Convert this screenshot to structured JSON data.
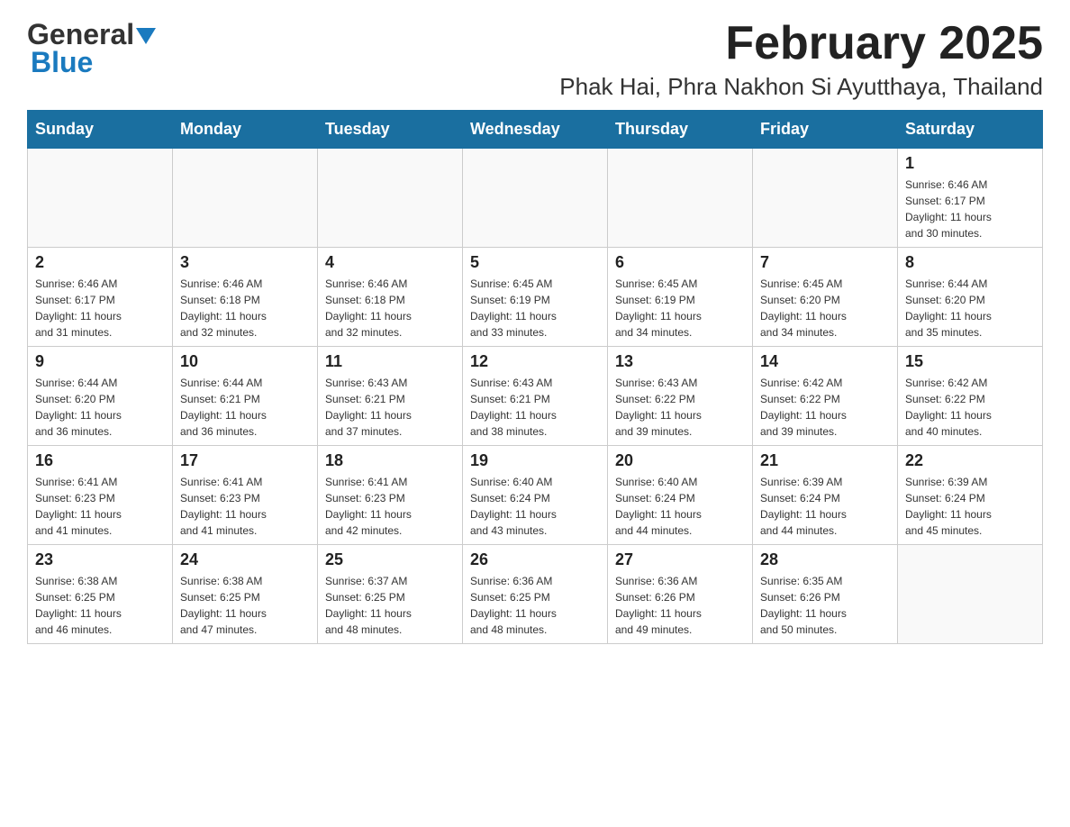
{
  "logo": {
    "text_general": "General",
    "text_blue": "Blue"
  },
  "title": "February 2025",
  "subtitle": "Phak Hai, Phra Nakhon Si Ayutthaya, Thailand",
  "weekdays": [
    "Sunday",
    "Monday",
    "Tuesday",
    "Wednesday",
    "Thursday",
    "Friday",
    "Saturday"
  ],
  "weeks": [
    [
      {
        "day": "",
        "info": ""
      },
      {
        "day": "",
        "info": ""
      },
      {
        "day": "",
        "info": ""
      },
      {
        "day": "",
        "info": ""
      },
      {
        "day": "",
        "info": ""
      },
      {
        "day": "",
        "info": ""
      },
      {
        "day": "1",
        "info": "Sunrise: 6:46 AM\nSunset: 6:17 PM\nDaylight: 11 hours\nand 30 minutes."
      }
    ],
    [
      {
        "day": "2",
        "info": "Sunrise: 6:46 AM\nSunset: 6:17 PM\nDaylight: 11 hours\nand 31 minutes."
      },
      {
        "day": "3",
        "info": "Sunrise: 6:46 AM\nSunset: 6:18 PM\nDaylight: 11 hours\nand 32 minutes."
      },
      {
        "day": "4",
        "info": "Sunrise: 6:46 AM\nSunset: 6:18 PM\nDaylight: 11 hours\nand 32 minutes."
      },
      {
        "day": "5",
        "info": "Sunrise: 6:45 AM\nSunset: 6:19 PM\nDaylight: 11 hours\nand 33 minutes."
      },
      {
        "day": "6",
        "info": "Sunrise: 6:45 AM\nSunset: 6:19 PM\nDaylight: 11 hours\nand 34 minutes."
      },
      {
        "day": "7",
        "info": "Sunrise: 6:45 AM\nSunset: 6:20 PM\nDaylight: 11 hours\nand 34 minutes."
      },
      {
        "day": "8",
        "info": "Sunrise: 6:44 AM\nSunset: 6:20 PM\nDaylight: 11 hours\nand 35 minutes."
      }
    ],
    [
      {
        "day": "9",
        "info": "Sunrise: 6:44 AM\nSunset: 6:20 PM\nDaylight: 11 hours\nand 36 minutes."
      },
      {
        "day": "10",
        "info": "Sunrise: 6:44 AM\nSunset: 6:21 PM\nDaylight: 11 hours\nand 36 minutes."
      },
      {
        "day": "11",
        "info": "Sunrise: 6:43 AM\nSunset: 6:21 PM\nDaylight: 11 hours\nand 37 minutes."
      },
      {
        "day": "12",
        "info": "Sunrise: 6:43 AM\nSunset: 6:21 PM\nDaylight: 11 hours\nand 38 minutes."
      },
      {
        "day": "13",
        "info": "Sunrise: 6:43 AM\nSunset: 6:22 PM\nDaylight: 11 hours\nand 39 minutes."
      },
      {
        "day": "14",
        "info": "Sunrise: 6:42 AM\nSunset: 6:22 PM\nDaylight: 11 hours\nand 39 minutes."
      },
      {
        "day": "15",
        "info": "Sunrise: 6:42 AM\nSunset: 6:22 PM\nDaylight: 11 hours\nand 40 minutes."
      }
    ],
    [
      {
        "day": "16",
        "info": "Sunrise: 6:41 AM\nSunset: 6:23 PM\nDaylight: 11 hours\nand 41 minutes."
      },
      {
        "day": "17",
        "info": "Sunrise: 6:41 AM\nSunset: 6:23 PM\nDaylight: 11 hours\nand 41 minutes."
      },
      {
        "day": "18",
        "info": "Sunrise: 6:41 AM\nSunset: 6:23 PM\nDaylight: 11 hours\nand 42 minutes."
      },
      {
        "day": "19",
        "info": "Sunrise: 6:40 AM\nSunset: 6:24 PM\nDaylight: 11 hours\nand 43 minutes."
      },
      {
        "day": "20",
        "info": "Sunrise: 6:40 AM\nSunset: 6:24 PM\nDaylight: 11 hours\nand 44 minutes."
      },
      {
        "day": "21",
        "info": "Sunrise: 6:39 AM\nSunset: 6:24 PM\nDaylight: 11 hours\nand 44 minutes."
      },
      {
        "day": "22",
        "info": "Sunrise: 6:39 AM\nSunset: 6:24 PM\nDaylight: 11 hours\nand 45 minutes."
      }
    ],
    [
      {
        "day": "23",
        "info": "Sunrise: 6:38 AM\nSunset: 6:25 PM\nDaylight: 11 hours\nand 46 minutes."
      },
      {
        "day": "24",
        "info": "Sunrise: 6:38 AM\nSunset: 6:25 PM\nDaylight: 11 hours\nand 47 minutes."
      },
      {
        "day": "25",
        "info": "Sunrise: 6:37 AM\nSunset: 6:25 PM\nDaylight: 11 hours\nand 48 minutes."
      },
      {
        "day": "26",
        "info": "Sunrise: 6:36 AM\nSunset: 6:25 PM\nDaylight: 11 hours\nand 48 minutes."
      },
      {
        "day": "27",
        "info": "Sunrise: 6:36 AM\nSunset: 6:26 PM\nDaylight: 11 hours\nand 49 minutes."
      },
      {
        "day": "28",
        "info": "Sunrise: 6:35 AM\nSunset: 6:26 PM\nDaylight: 11 hours\nand 50 minutes."
      },
      {
        "day": "",
        "info": ""
      }
    ]
  ]
}
